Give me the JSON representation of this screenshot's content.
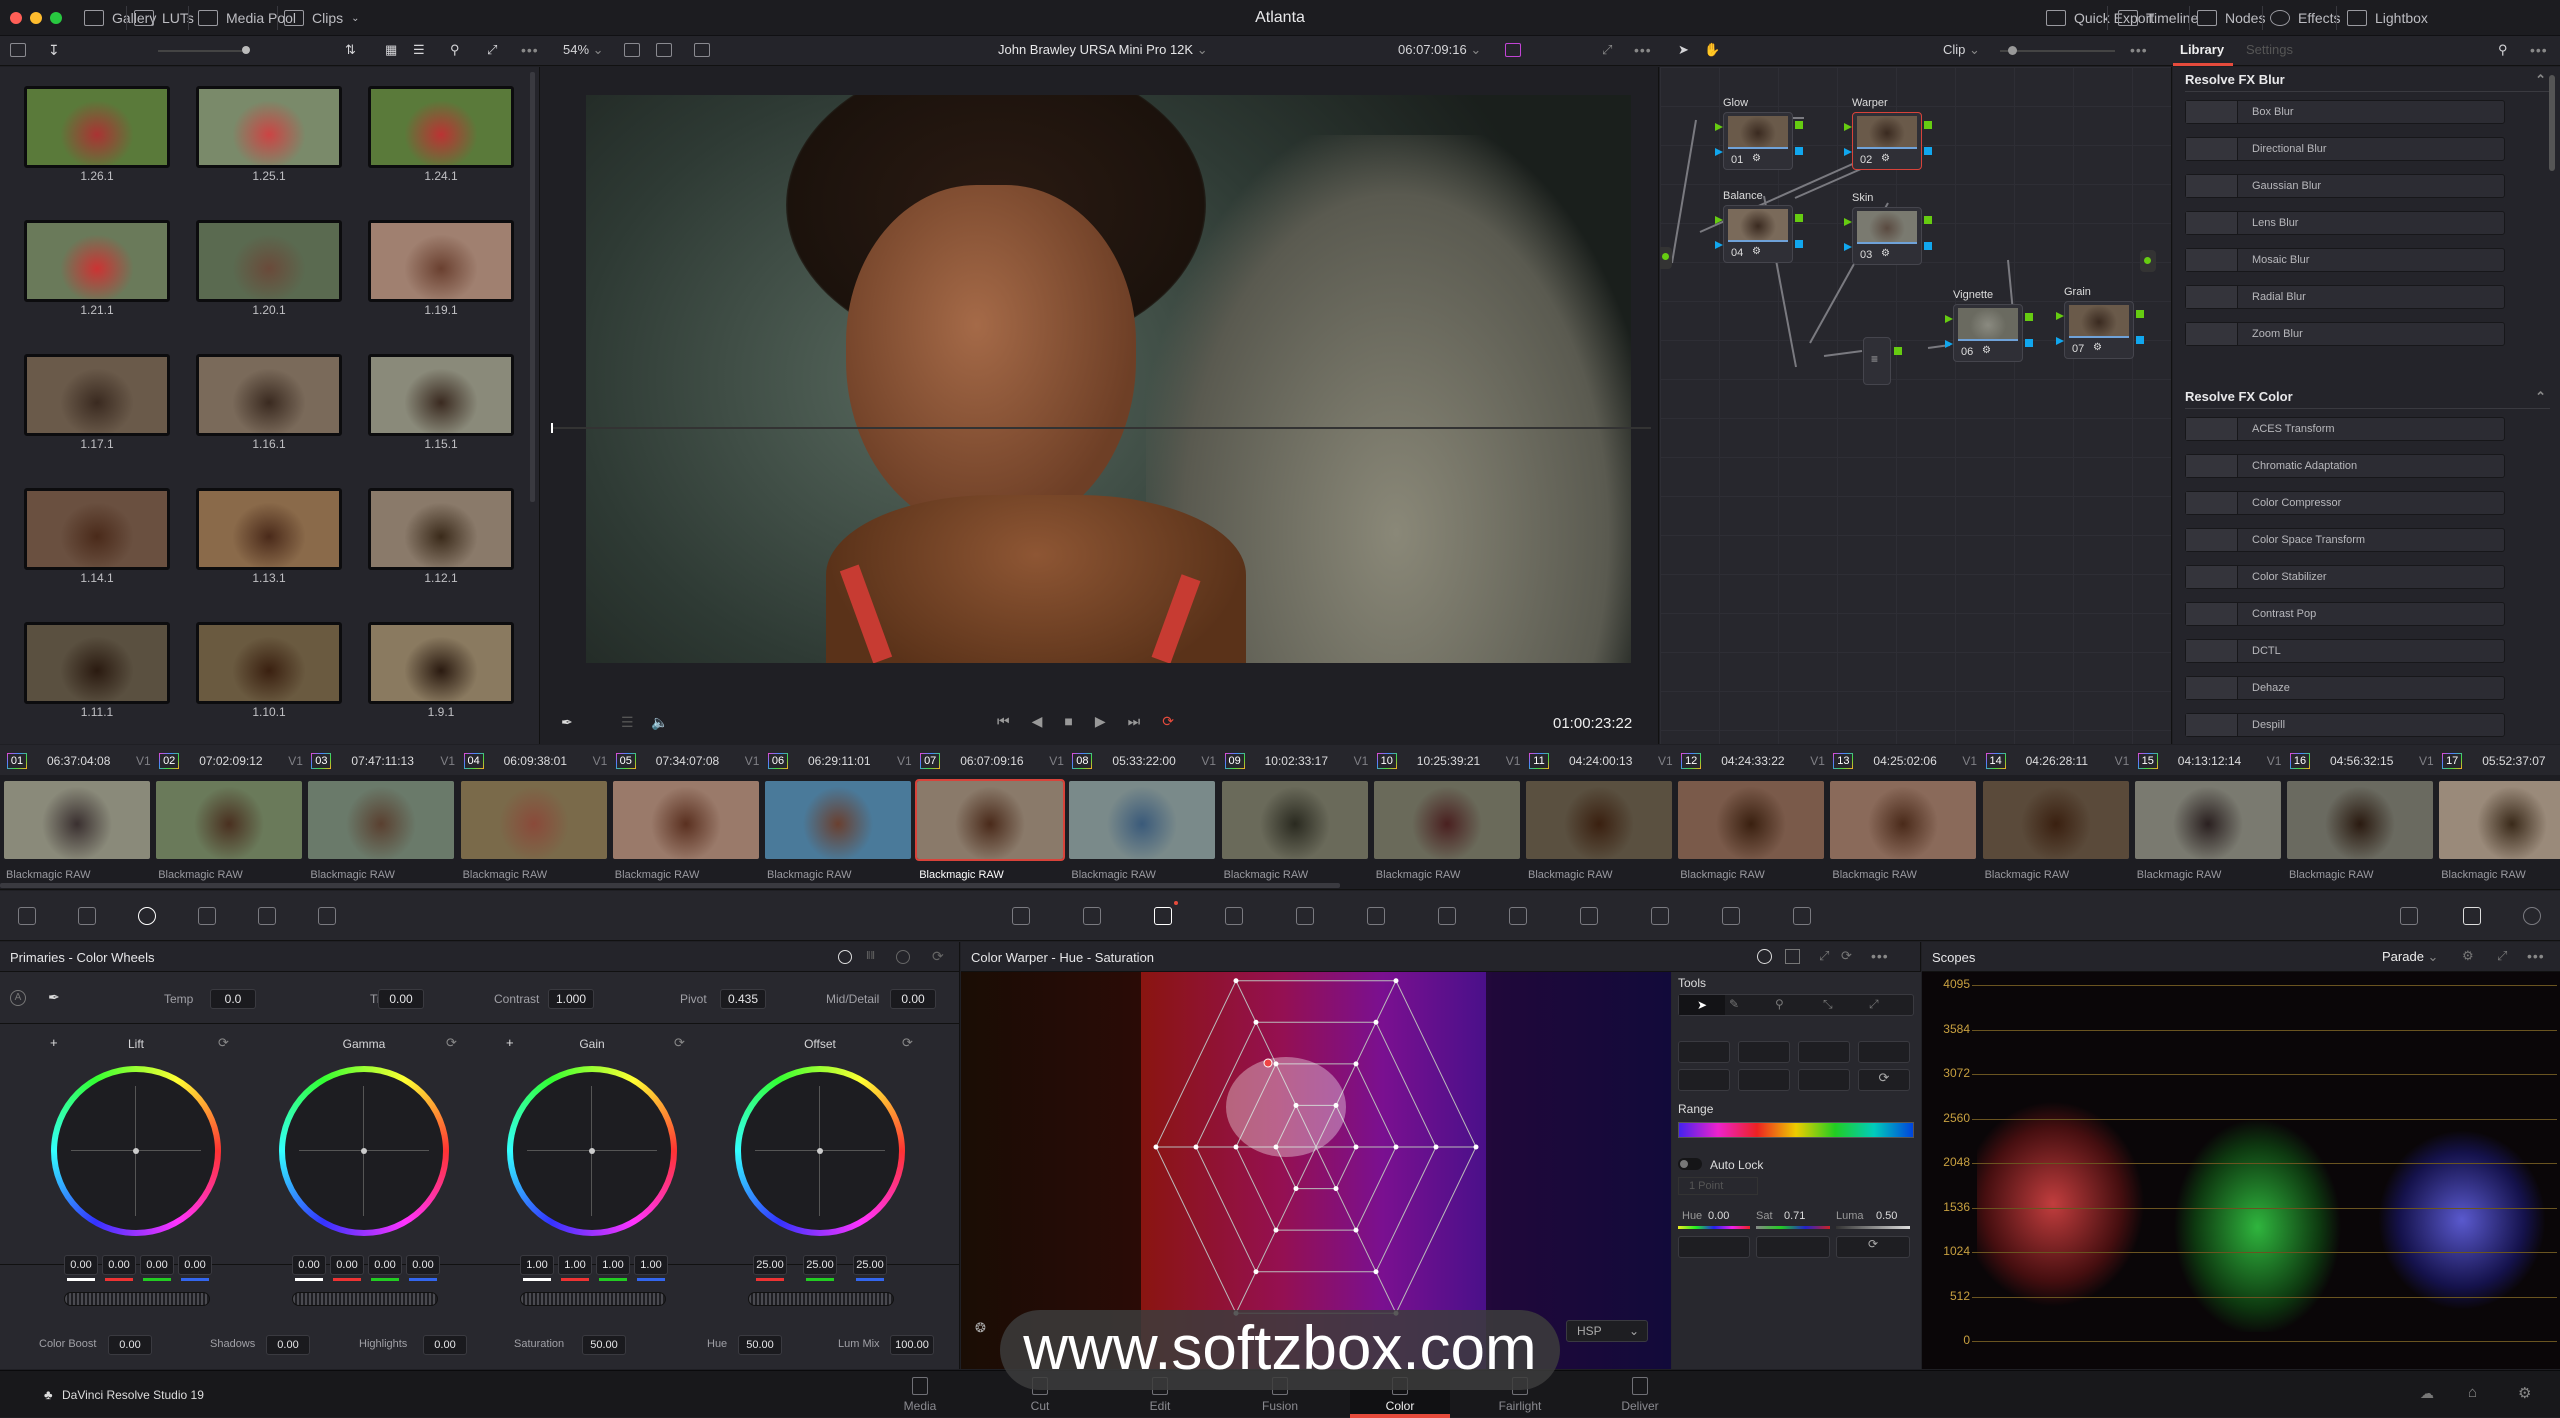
{
  "window": {
    "title": "Atlanta",
    "colors": {
      "close": "#ff5f57",
      "minimize": "#febc2e",
      "maximize": "#28c840"
    }
  },
  "topbar": {
    "left": [
      {
        "label": "Gallery",
        "icon": "gallery-icon"
      },
      {
        "label": "LUTs",
        "icon": "luts-icon"
      },
      {
        "label": "Media Pool",
        "icon": "media-pool-icon"
      },
      {
        "label": "Clips",
        "icon": "clips-icon"
      }
    ],
    "right": [
      {
        "label": "Quick Export",
        "icon": "export-icon"
      },
      {
        "label": "Timeline",
        "icon": "timeline-icon"
      },
      {
        "label": "Nodes",
        "icon": "nodes-icon"
      },
      {
        "label": "Effects",
        "icon": "fx-icon"
      },
      {
        "label": "Lightbox",
        "icon": "lightbox-icon"
      }
    ]
  },
  "viewer": {
    "zoom": "54%",
    "clip_title": "John Brawley URSA Mini Pro 12K",
    "timecode": "06:07:09:16",
    "playhead_timecode": "01:00:23:22",
    "loop_color": "#e64b3c"
  },
  "node_editor": {
    "mode": "Clip",
    "nodes": [
      {
        "num": "01",
        "label": "Glow",
        "icon": "fx-icon"
      },
      {
        "num": "02",
        "label": "Warper",
        "icon": "warper-icon",
        "selected": true
      },
      {
        "num": "04",
        "label": "Balance",
        "icon": "bars-icon"
      },
      {
        "num": "03",
        "label": "Skin",
        "icon": "qualifier-icon"
      },
      {
        "num": "06",
        "label": "Vignette",
        "icon": "curve-window-icon"
      },
      {
        "num": "07",
        "label": "Grain",
        "icon": "fx-icon"
      }
    ]
  },
  "library": {
    "tabs": [
      "Library",
      "Settings"
    ],
    "active_tab": "Library",
    "sections": [
      {
        "title": "Resolve FX Blur",
        "items": [
          "Box Blur",
          "Directional Blur",
          "Gaussian Blur",
          "Lens Blur",
          "Mosaic Blur",
          "Radial Blur",
          "Zoom Blur"
        ]
      },
      {
        "title": "Resolve FX Color",
        "items": [
          "ACES Transform",
          "Chromatic Adaptation",
          "Color Compressor",
          "Color Space Transform",
          "Color Stabilizer",
          "Contrast Pop",
          "DCTL",
          "Dehaze",
          "Despill"
        ]
      }
    ]
  },
  "gallery": {
    "stills": [
      "1.26.1",
      "1.25.1",
      "1.24.1",
      "1.21.1",
      "1.20.1",
      "1.19.1",
      "1.17.1",
      "1.16.1",
      "1.15.1",
      "1.14.1",
      "1.13.1",
      "1.12.1",
      "1.11.1",
      "1.10.1",
      "1.9.1"
    ]
  },
  "clips": {
    "track": "V1",
    "codec": "Blackmagic RAW",
    "selected": "07",
    "items": [
      {
        "num": "01",
        "tc": "06:37:04:08"
      },
      {
        "num": "02",
        "tc": "07:02:09:12"
      },
      {
        "num": "03",
        "tc": "07:47:11:13"
      },
      {
        "num": "04",
        "tc": "06:09:38:01"
      },
      {
        "num": "05",
        "tc": "07:34:07:08"
      },
      {
        "num": "06",
        "tc": "06:29:11:01"
      },
      {
        "num": "07",
        "tc": "06:07:09:16"
      },
      {
        "num": "08",
        "tc": "05:33:22:00"
      },
      {
        "num": "09",
        "tc": "10:02:33:17"
      },
      {
        "num": "10",
        "tc": "10:25:39:21"
      },
      {
        "num": "11",
        "tc": "04:24:00:13"
      },
      {
        "num": "12",
        "tc": "04:24:33:22"
      },
      {
        "num": "13",
        "tc": "04:25:02:06"
      },
      {
        "num": "14",
        "tc": "04:26:28:11"
      },
      {
        "num": "15",
        "tc": "04:13:12:14"
      },
      {
        "num": "16",
        "tc": "04:56:32:15"
      },
      {
        "num": "17",
        "tc": "05:52:37:07"
      }
    ]
  },
  "primaries": {
    "title": "Primaries - Color Wheels",
    "adjust": [
      {
        "label": "Temp",
        "value": "0.0"
      },
      {
        "label": "Tint",
        "value": "0.00"
      },
      {
        "label": "Contrast",
        "value": "1.000"
      },
      {
        "label": "Pivot",
        "value": "0.435"
      },
      {
        "label": "Mid/Detail",
        "value": "0.00"
      }
    ],
    "wheels": [
      {
        "label": "Lift",
        "values": [
          "0.00",
          "0.00",
          "0.00",
          "0.00"
        ]
      },
      {
        "label": "Gamma",
        "values": [
          "0.00",
          "0.00",
          "0.00",
          "0.00"
        ]
      },
      {
        "label": "Gain",
        "values": [
          "1.00",
          "1.00",
          "1.00",
          "1.00"
        ]
      },
      {
        "label": "Offset",
        "values": [
          "25.00",
          "25.00",
          "25.00"
        ]
      }
    ],
    "bottom": [
      {
        "label": "Color Boost",
        "value": "0.00"
      },
      {
        "label": "Shadows",
        "value": "0.00"
      },
      {
        "label": "Highlights",
        "value": "0.00"
      },
      {
        "label": "Saturation",
        "value": "50.00"
      },
      {
        "label": "Hue",
        "value": "50.00"
      },
      {
        "label": "Lum Mix",
        "value": "100.00"
      }
    ]
  },
  "warper": {
    "title": "Color Warper - Hue - Saturation",
    "tools_label": "Tools",
    "range_label": "Range",
    "auto_lock_label": "Auto Lock",
    "auto_lock": false,
    "points_select": "1 Point",
    "hue_label": "Hue",
    "hue": "0.00",
    "sat_label": "Sat",
    "sat": "0.71",
    "luma_label": "Luma",
    "luma": "0.50",
    "colorspace": "HSP"
  },
  "scopes": {
    "title": "Scopes",
    "mode": "Parade",
    "scale": [
      "4095",
      "3584",
      "3072",
      "2560",
      "2048",
      "1536",
      "1024",
      "512",
      "0"
    ]
  },
  "footer": {
    "app_name": "DaVinci Resolve Studio 19",
    "pages": [
      "Media",
      "Cut",
      "Edit",
      "Fusion",
      "Color",
      "Fairlight",
      "Deliver"
    ],
    "active_page": "Color"
  },
  "watermark": "www.softzbox.com"
}
